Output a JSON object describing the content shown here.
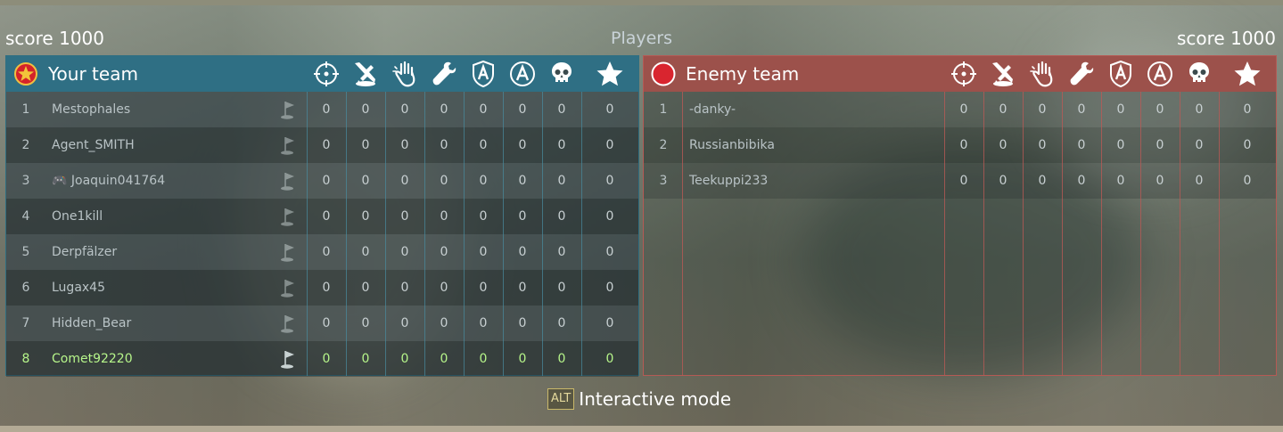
{
  "header": {
    "title": "Players",
    "your_score": "score 1000",
    "enemy_score": "score 1000"
  },
  "stat_columns": [
    "crosshair-icon",
    "aircraft-destroyed-icon",
    "hand-icon",
    "wrench-icon",
    "ground-assist-icon",
    "assist-icon",
    "skull-icon",
    "star-icon"
  ],
  "your_team": {
    "name": "Your team",
    "emblem": "red-star-icon",
    "accent": "#2f6f84",
    "players": [
      {
        "rank": "1",
        "name": "Mestophales",
        "stats": [
          "0",
          "0",
          "0",
          "0",
          "0",
          "0",
          "0",
          "0"
        ]
      },
      {
        "rank": "2",
        "name": "Agent_SMITH",
        "stats": [
          "0",
          "0",
          "0",
          "0",
          "0",
          "0",
          "0",
          "0"
        ]
      },
      {
        "rank": "3",
        "name": "🎮 Joaquin041764",
        "stats": [
          "0",
          "0",
          "0",
          "0",
          "0",
          "0",
          "0",
          "0"
        ]
      },
      {
        "rank": "4",
        "name": "One1kill",
        "stats": [
          "0",
          "0",
          "0",
          "0",
          "0",
          "0",
          "0",
          "0"
        ]
      },
      {
        "rank": "5",
        "name": "Derpfälzer",
        "stats": [
          "0",
          "0",
          "0",
          "0",
          "0",
          "0",
          "0",
          "0"
        ]
      },
      {
        "rank": "6",
        "name": "Lugax45",
        "stats": [
          "0",
          "0",
          "0",
          "0",
          "0",
          "0",
          "0",
          "0"
        ]
      },
      {
        "rank": "7",
        "name": "Hidden_Bear",
        "stats": [
          "0",
          "0",
          "0",
          "0",
          "0",
          "0",
          "0",
          "0"
        ]
      },
      {
        "rank": "8",
        "name": "Comet92220",
        "stats": [
          "0",
          "0",
          "0",
          "0",
          "0",
          "0",
          "0",
          "0"
        ],
        "is_you": true
      }
    ]
  },
  "enemy_team": {
    "name": "Enemy team",
    "emblem": "red-circle-icon",
    "accent": "#9c514b",
    "players": [
      {
        "rank": "1",
        "name": "-danky-",
        "stats": [
          "0",
          "0",
          "0",
          "0",
          "0",
          "0",
          "0",
          "0"
        ]
      },
      {
        "rank": "2",
        "name": "Russianbibika",
        "stats": [
          "0",
          "0",
          "0",
          "0",
          "0",
          "0",
          "0",
          "0"
        ]
      },
      {
        "rank": "3",
        "name": "Teekuppi233",
        "stats": [
          "0",
          "0",
          "0",
          "0",
          "0",
          "0",
          "0",
          "0"
        ]
      }
    ]
  },
  "footer": {
    "key": "ALT",
    "label": "Interactive mode"
  },
  "colors": {
    "highlight_player": "#b6f58a",
    "alt_key": "#c9b86a"
  }
}
